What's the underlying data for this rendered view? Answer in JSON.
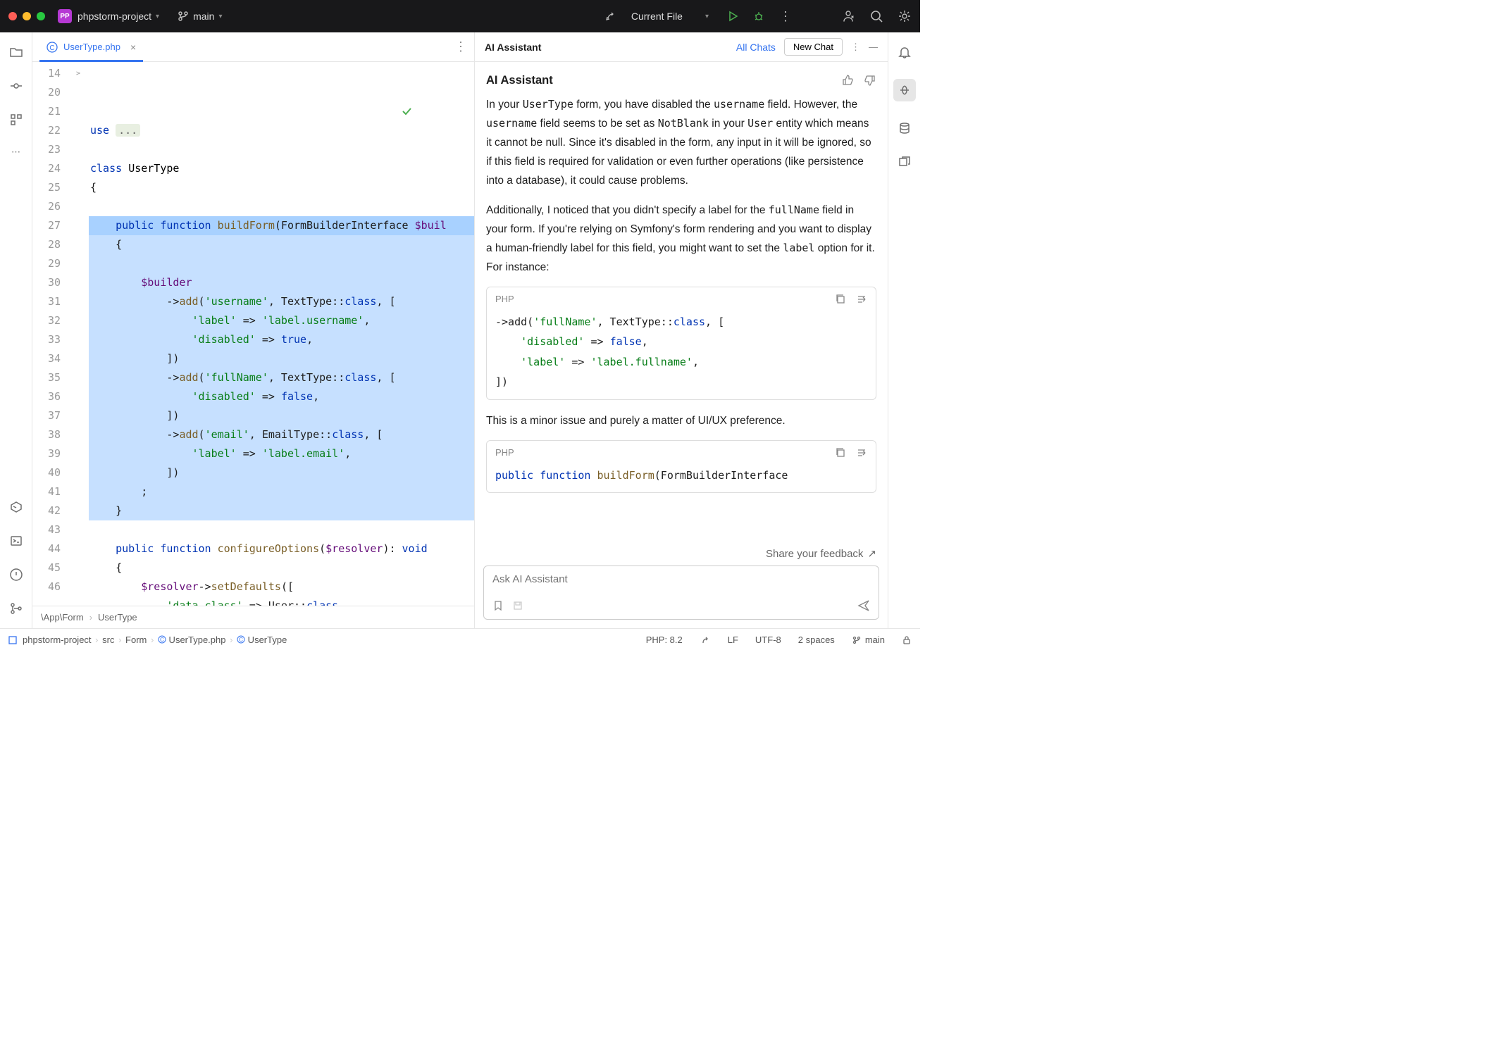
{
  "titlebar": {
    "project": "phpstorm-project",
    "project_badge": "PP",
    "branch": "main",
    "run_config": "Current File"
  },
  "tabs": [
    {
      "name": "UserType.php",
      "active": true
    }
  ],
  "gutter_start": 14,
  "code_lines": [
    {
      "n": 14,
      "fold": ">",
      "hl": false,
      "html": "<span class='kw'>use</span> <span class='fold-bg'>...</span>"
    },
    {
      "n": 20,
      "hl": false,
      "html": ""
    },
    {
      "n": 21,
      "hl": false,
      "html": "<span class='kw'>class</span> <span class='cls'>UserType</span>"
    },
    {
      "n": 22,
      "hl": false,
      "html": "{"
    },
    {
      "n": 23,
      "hl": false,
      "html": ""
    },
    {
      "n": 24,
      "hl": "cur",
      "html": "    <span class='kw'>public</span> <span class='kw'>function</span> <span class='fn'>buildForm</span>(FormBuilderInterface <span class='var'>$buil</span>"
    },
    {
      "n": 25,
      "hl": true,
      "html": "    {"
    },
    {
      "n": 26,
      "hl": true,
      "html": ""
    },
    {
      "n": 27,
      "hl": true,
      "html": "        <span class='var'>$builder</span>"
    },
    {
      "n": 28,
      "hl": true,
      "html": "            -&gt;<span class='fn'>add</span>(<span class='str'>'username'</span>, TextType::<span class='kw'>class</span>, ["
    },
    {
      "n": 29,
      "hl": true,
      "html": "                <span class='str'>'label'</span> =&gt; <span class='str'>'label.username'</span>,"
    },
    {
      "n": 30,
      "hl": true,
      "html": "                <span class='str'>'disabled'</span> =&gt; <span class='bool'>true</span>,"
    },
    {
      "n": 31,
      "hl": true,
      "html": "            ])"
    },
    {
      "n": 32,
      "hl": true,
      "html": "            -&gt;<span class='fn'>add</span>(<span class='str'>'fullName'</span>, TextType::<span class='kw'>class</span>, ["
    },
    {
      "n": 33,
      "hl": true,
      "html": "                <span class='str'>'disabled'</span> =&gt; <span class='bool'>false</span>,"
    },
    {
      "n": 34,
      "hl": true,
      "html": "            ])"
    },
    {
      "n": 35,
      "hl": true,
      "html": "            -&gt;<span class='fn'>add</span>(<span class='str'>'email'</span>, EmailType::<span class='kw'>class</span>, ["
    },
    {
      "n": 36,
      "hl": true,
      "html": "                <span class='str'>'label'</span> =&gt; <span class='str'>'label.email'</span>,"
    },
    {
      "n": 37,
      "hl": true,
      "html": "            ])"
    },
    {
      "n": 38,
      "hl": true,
      "html": "        ;"
    },
    {
      "n": 39,
      "hl": true,
      "html": "    }"
    },
    {
      "n": 40,
      "hl": false,
      "html": ""
    },
    {
      "n": 41,
      "hl": false,
      "html": "    <span class='kw'>public</span> <span class='kw'>function</span> <span class='fn'>configureOptions</span>(<span class='var'>$resolver</span>): <span class='kw'>void</span>"
    },
    {
      "n": 42,
      "hl": false,
      "html": "    {"
    },
    {
      "n": 43,
      "hl": false,
      "html": "        <span class='var'>$resolver</span>-&gt;<span class='fn'>setDefaults</span>(["
    },
    {
      "n": 44,
      "hl": false,
      "html": "            <span class='str'>'data_class'</span> =&gt; User::<span class='kw'>class</span>,"
    },
    {
      "n": 45,
      "hl": false,
      "html": "        ]);"
    },
    {
      "n": 46,
      "hl": false,
      "html": "    }"
    }
  ],
  "crumb_editor": [
    "\\App\\Form",
    "UserType"
  ],
  "ai": {
    "panel_title": "AI Assistant",
    "all_chats": "All Chats",
    "new_chat": "New Chat",
    "heading": "AI Assistant",
    "para1_before_code1": "In your ",
    "code1": "UserType",
    "para1_mid1": " form, you have disabled the ",
    "code2": "username",
    "para1_mid2": " field. However, the ",
    "code3": "username",
    "para1_mid3": " field seems to be set as ",
    "code4": "NotBlank",
    "para1_mid4": " in your ",
    "code5": "User",
    "para1_end": " entity which means it cannot be null. Since it's disabled in the form, any input in it will be ignored, so if this field is required for validation or even further operations (like persistence into a database), it could cause problems.",
    "para2_before": "Additionally, I noticed that you didn't specify a label for the ",
    "code6": "fullName",
    "para2_mid": " field in your form. If you're relying on Symfony's form rendering and you want to display a human-friendly label for this field, you might want to set the ",
    "code7": "label",
    "para2_end": " option for it. For instance:",
    "block1_lang": "PHP",
    "block1_code": "->add(<span class='str'>'fullName'</span>, TextType::<span class='kw'>class</span>, [\n    <span class='str'>'disabled'</span> => <span class='bool'>false</span>,\n    <span class='str'>'label'</span> => <span class='str'>'label.fullname'</span>,\n])",
    "para3": "This is a minor issue and purely a matter of UI/UX preference.",
    "block2_lang": "PHP",
    "block2_code": "<span class='kw'>public</span> <span class='kw'>function</span> <span class='fn'>buildForm</span>(FormBuilderInterface",
    "feedback": "Share your feedback",
    "input_placeholder": "Ask AI Assistant"
  },
  "breadcrumbs": [
    "phpstorm-project",
    "src",
    "Form",
    "UserType.php",
    "UserType"
  ],
  "status": {
    "php": "PHP: 8.2",
    "lf": "LF",
    "enc": "UTF-8",
    "indent": "2 spaces",
    "branch": "main"
  }
}
